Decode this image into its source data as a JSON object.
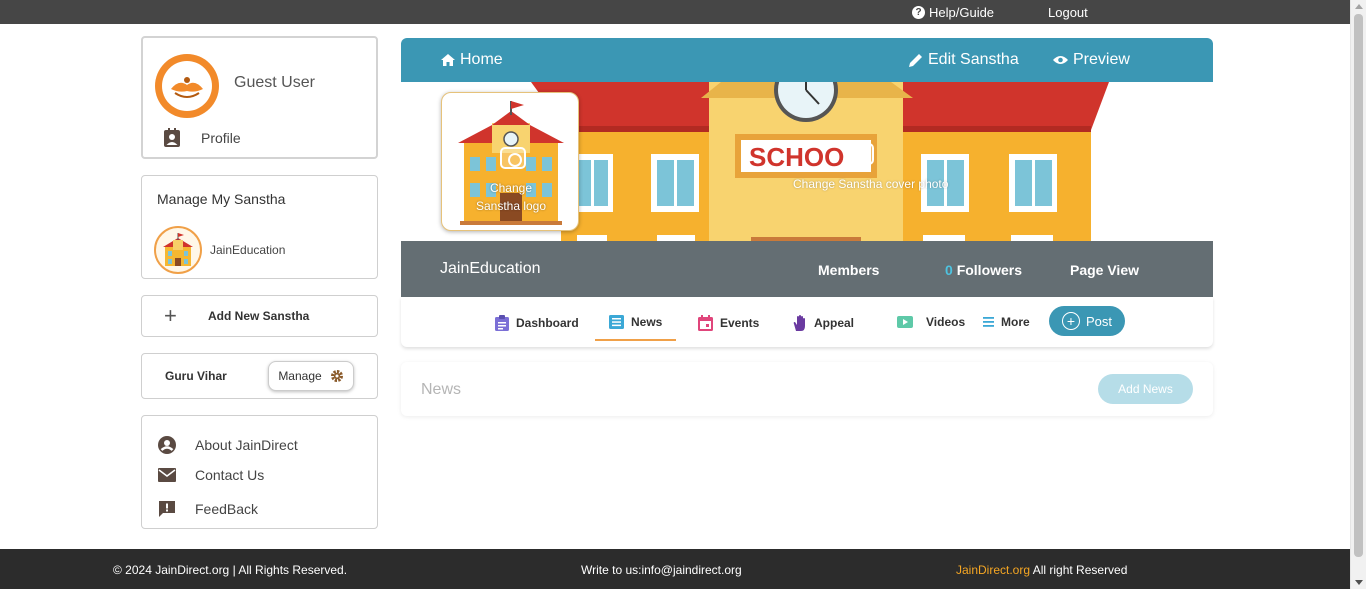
{
  "topbar": {
    "help_label": "Help/Guide",
    "help_icon": "?",
    "logout_label": "Logout"
  },
  "profile": {
    "user_name": "Guest User",
    "profile_label": "Profile"
  },
  "manage": {
    "title": "Manage My Sanstha",
    "sanstha_name": "JainEducation"
  },
  "add_sanstha": {
    "icon": "+",
    "label": "Add New Sanstha"
  },
  "guru": {
    "name": "Guru Vihar",
    "manage_label": "Manage"
  },
  "about": {
    "items": [
      {
        "label": "About JainDirect"
      },
      {
        "label": "Contact Us"
      },
      {
        "label": "FeedBack"
      }
    ]
  },
  "header": {
    "home_label": "Home",
    "edit_label": "Edit Sanstha",
    "preview_label": "Preview"
  },
  "cover": {
    "logo_change_line1": "Change",
    "logo_change_line2": "Sanstha logo",
    "cover_change_label": "Change Sanstha cover photo",
    "sign_text": "SCHOO"
  },
  "stats": {
    "sanstha_name": "JainEducation",
    "members_label": "Members",
    "followers_count": "0",
    "followers_label": "Followers",
    "page_view_label": "Page View"
  },
  "tabs": {
    "dashboard": "Dashboard",
    "news": "News",
    "events": "Events",
    "appeal": "Appeal",
    "videos": "Videos",
    "more": "More",
    "post_icon": "+",
    "post_label": "Post"
  },
  "news": {
    "title": "News",
    "add_label": "Add News"
  },
  "footer": {
    "copyright": "© 2024 JainDirect.org | All Rights Reserved.",
    "write": "Write to us:info@jaindirect.org",
    "brand": "JainDirect.org",
    "rights": " All right Reserved"
  },
  "colors": {
    "primary": "#3b97b4",
    "stat_bar": "#646e73",
    "accent": "#f0a048",
    "footer_bg": "#2c2c2c"
  }
}
